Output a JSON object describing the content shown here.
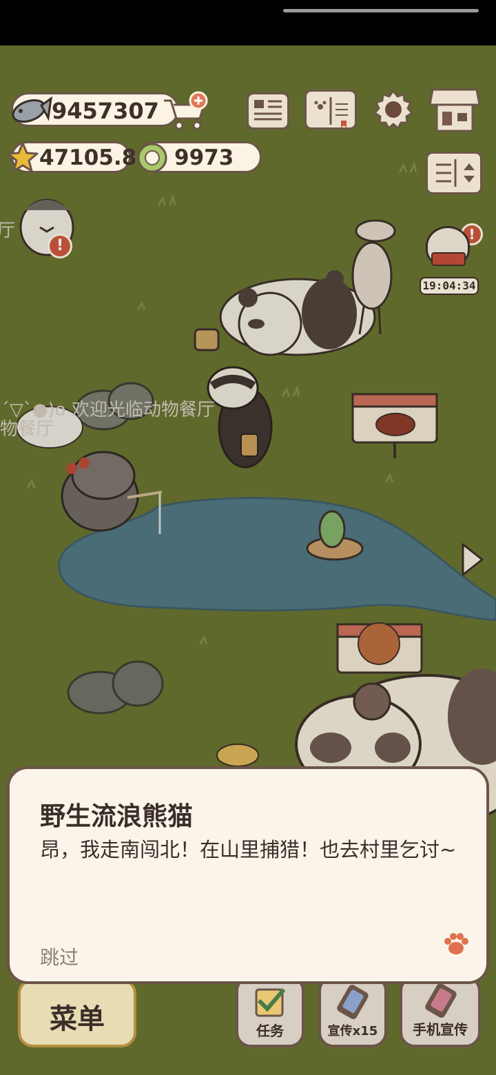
{
  "currency": {
    "fish": "9457307",
    "stars": "47105.8",
    "coins": "9973"
  },
  "timer": "19:04:34",
  "speech_bubble": {
    "line1": "(●´▽`●)o 欢迎光临动物餐厅",
    "line2": "物餐厅",
    "edge_text": "厅"
  },
  "dialog": {
    "speaker": "野生流浪熊猫",
    "text": "昂，我走南闯北！在山里捕猎！也去村里乞讨~",
    "skip": "跳过"
  },
  "bottom_bar": {
    "menu": "菜单",
    "tasks": "任务",
    "promote": "宣传x15",
    "phone_promote": "手机宣传"
  },
  "colors": {
    "grass": "#66702f",
    "pond": "#4f7480",
    "panel": "#fbf4ea",
    "outline": "#6b5548",
    "accent_paw": "#e0714f"
  }
}
